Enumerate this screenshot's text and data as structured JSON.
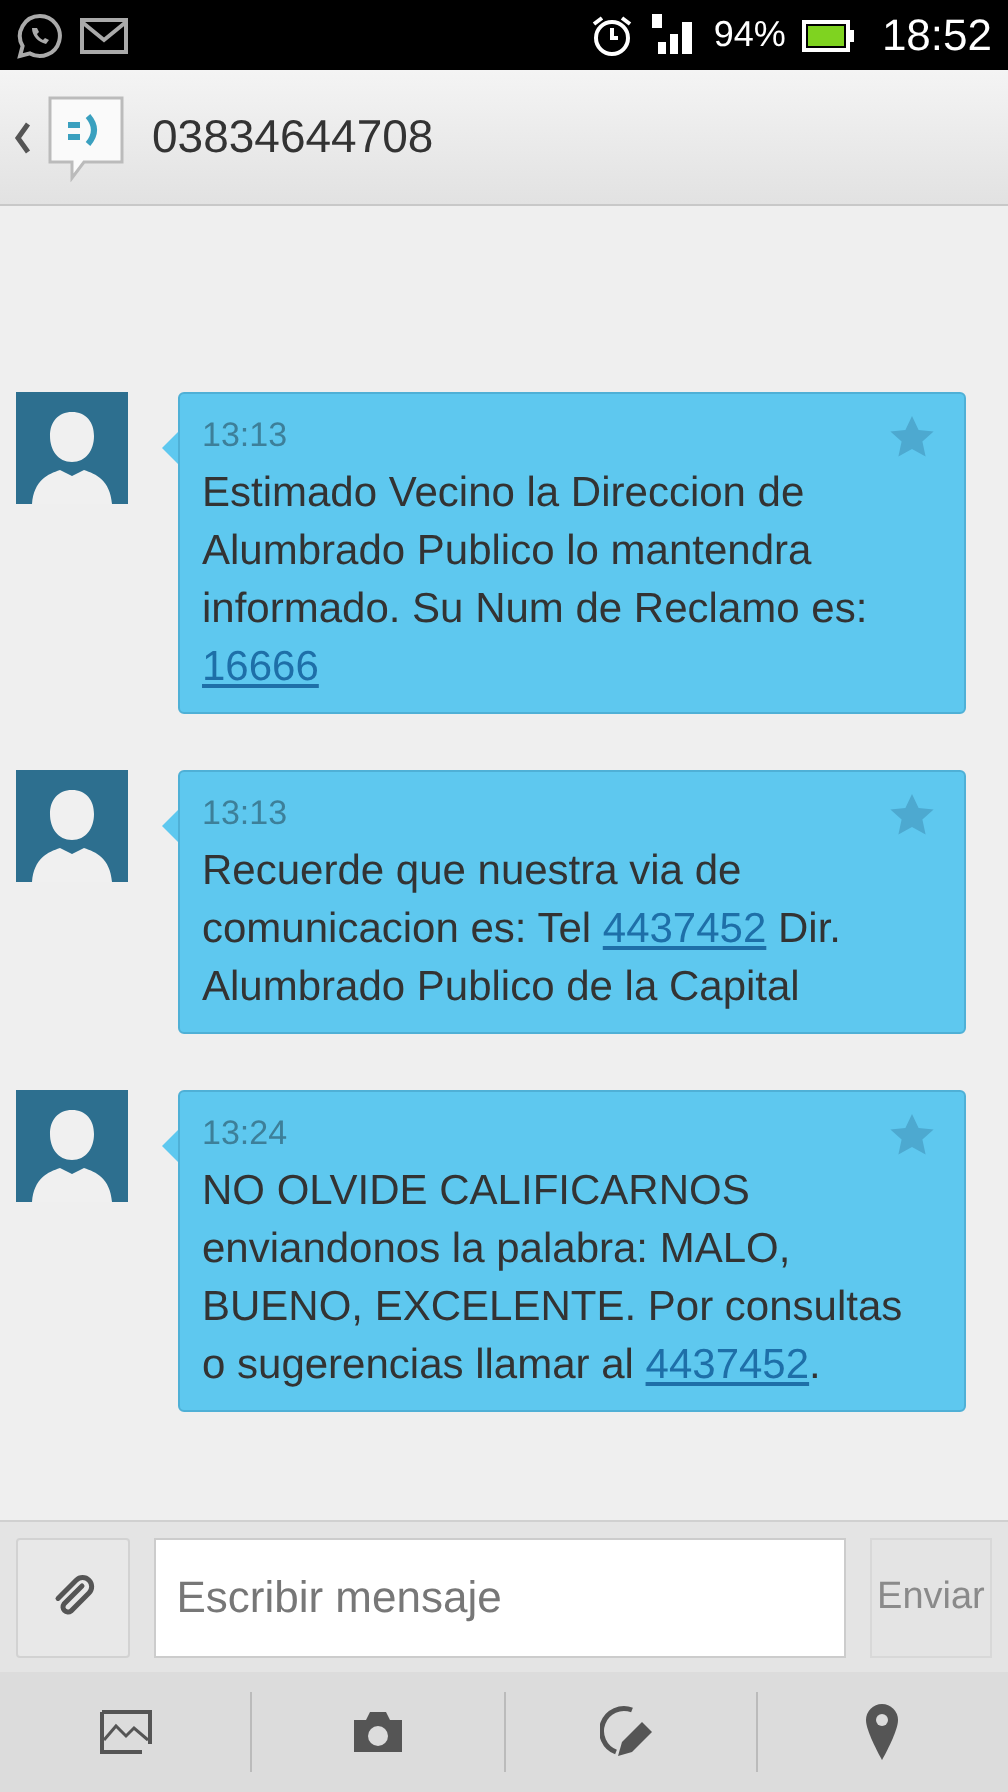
{
  "status_bar": {
    "battery": "94%",
    "time": "18:52"
  },
  "header": {
    "title": "03834644708"
  },
  "messages": [
    {
      "time": "13:13",
      "starred": false,
      "parts": [
        {
          "kind": "text",
          "text": "Estimado Vecino la Direccion de Alumbrado Publico lo mantendra informado. Su Num de Reclamo es: "
        },
        {
          "kind": "link",
          "text": "16666"
        }
      ]
    },
    {
      "time": "13:13",
      "starred": false,
      "parts": [
        {
          "kind": "text",
          "text": "Recuerde que nuestra via de comunicacion es: Tel "
        },
        {
          "kind": "link",
          "text": "4437452"
        },
        {
          "kind": "text",
          "text": " Dir. Alumbrado Publico de la Capital"
        }
      ]
    },
    {
      "time": "13:24",
      "starred": false,
      "parts": [
        {
          "kind": "text",
          "text": "NO OLVIDE CALIFICARNOS enviandonos la palabra: MALO, BUENO, EXCELENTE. Por consultas o sugerencias llamar al "
        },
        {
          "kind": "link",
          "text": "4437452"
        },
        {
          "kind": "text",
          "text": "."
        }
      ]
    }
  ],
  "composer": {
    "placeholder": "Escribir mensaje",
    "send": "Enviar",
    "send_disabled": true
  }
}
